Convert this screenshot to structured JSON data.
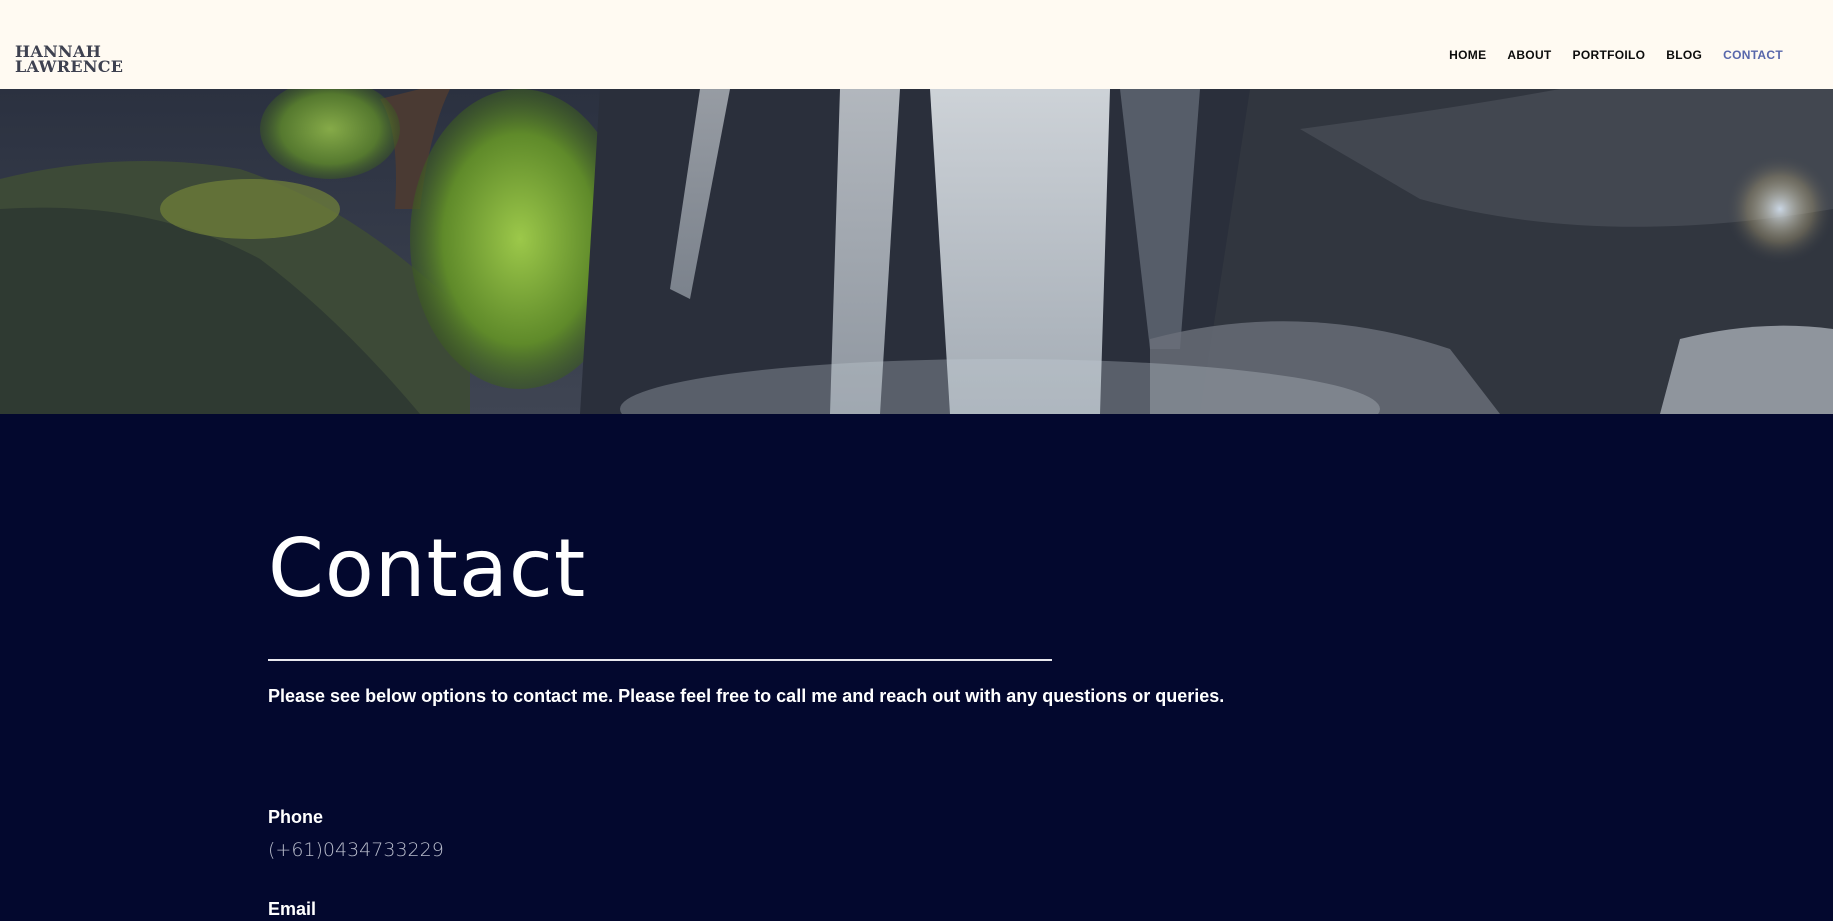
{
  "brand": {
    "line1": "HANNAH",
    "line2": "LAWRENCE"
  },
  "nav": {
    "items": [
      {
        "label": "HOME"
      },
      {
        "label": "ABOUT"
      },
      {
        "label": "PORTFOILO"
      },
      {
        "label": "BLOG"
      },
      {
        "label": "CONTACT",
        "active": true
      }
    ],
    "active_color": "#5867ab"
  },
  "hero": {
    "image": "waterfall-photo"
  },
  "page": {
    "title": "Contact",
    "intro": "Please see below options to contact me. Please feel free to call me and reach out with any questions or queries."
  },
  "contact": {
    "phone_label": "Phone",
    "phone_value": "(+61)0434733229",
    "email_label": "Email"
  },
  "colors": {
    "header_bg": "#fffaf2",
    "content_bg": "#03082e",
    "text": "#ffffff",
    "muted": "#b9bdcc"
  }
}
